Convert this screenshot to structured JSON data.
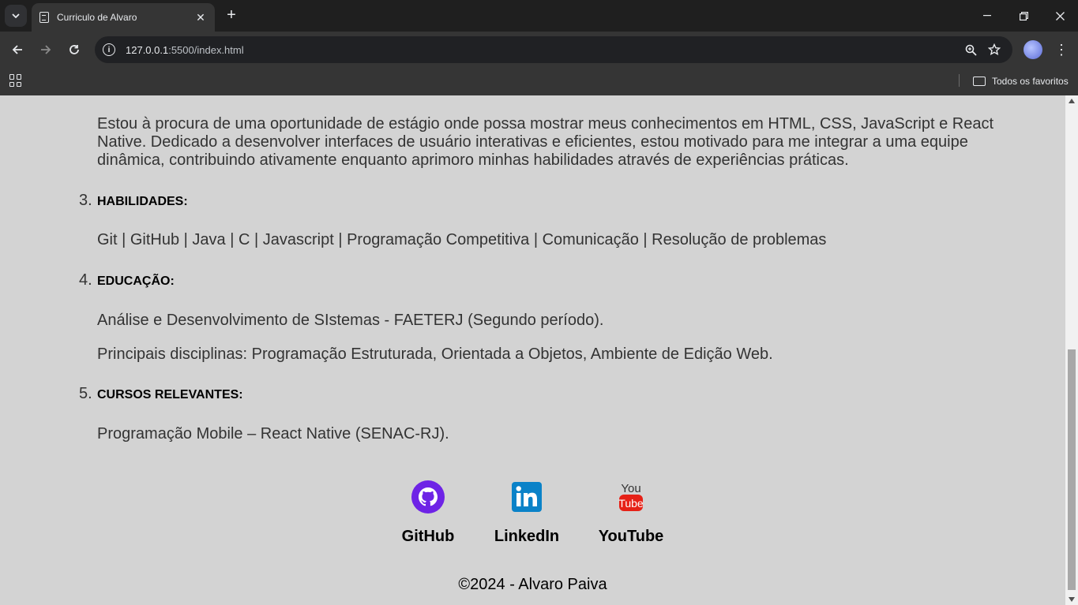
{
  "browser": {
    "tab_title": "Curriculo de Alvaro",
    "url_host": "127.0.0.1",
    "url_path": ":5500/index.html",
    "bookmarks_label": "Todos os favoritos"
  },
  "resume": {
    "objective_text": "Estou à procura de uma oportunidade de estágio onde possa mostrar meus conhecimentos em HTML, CSS, JavaScript e React Native. Dedicado a desenvolver interfaces de usuário interativas e eficientes, estou motivado para me integrar a uma equipe dinâmica, contribuindo ativamente enquanto aprimoro minhas habilidades através de experiências práticas.",
    "sections": [
      {
        "number": "3.",
        "title": "HABILIDADES:",
        "lines": [
          "Git | GitHub | Java | C | Javascript | Programação Competitiva | Comunicação | Resolução de problemas"
        ]
      },
      {
        "number": "4.",
        "title": "EDUCAÇÃO:",
        "lines": [
          "Análise e Desenvolvimento de SIstemas - FAETERJ (Segundo período).",
          "Principais disciplinas: Programação Estruturada, Orientada a Objetos, Ambiente de Edição Web."
        ]
      },
      {
        "number": "5.",
        "title": "CURSOS RELEVANTES:",
        "lines": [
          "Programação Mobile – React Native (SENAC-RJ)."
        ]
      }
    ]
  },
  "social": [
    {
      "label": "GitHub",
      "icon": "github-icon",
      "color": "#6e23e6"
    },
    {
      "label": "LinkedIn",
      "icon": "linkedin-icon",
      "color": "#0a82c8"
    },
    {
      "label": "YouTube",
      "icon": "youtube-icon",
      "color": "#e62117"
    }
  ],
  "footer": {
    "text": "©2024 - Alvaro Paiva"
  }
}
